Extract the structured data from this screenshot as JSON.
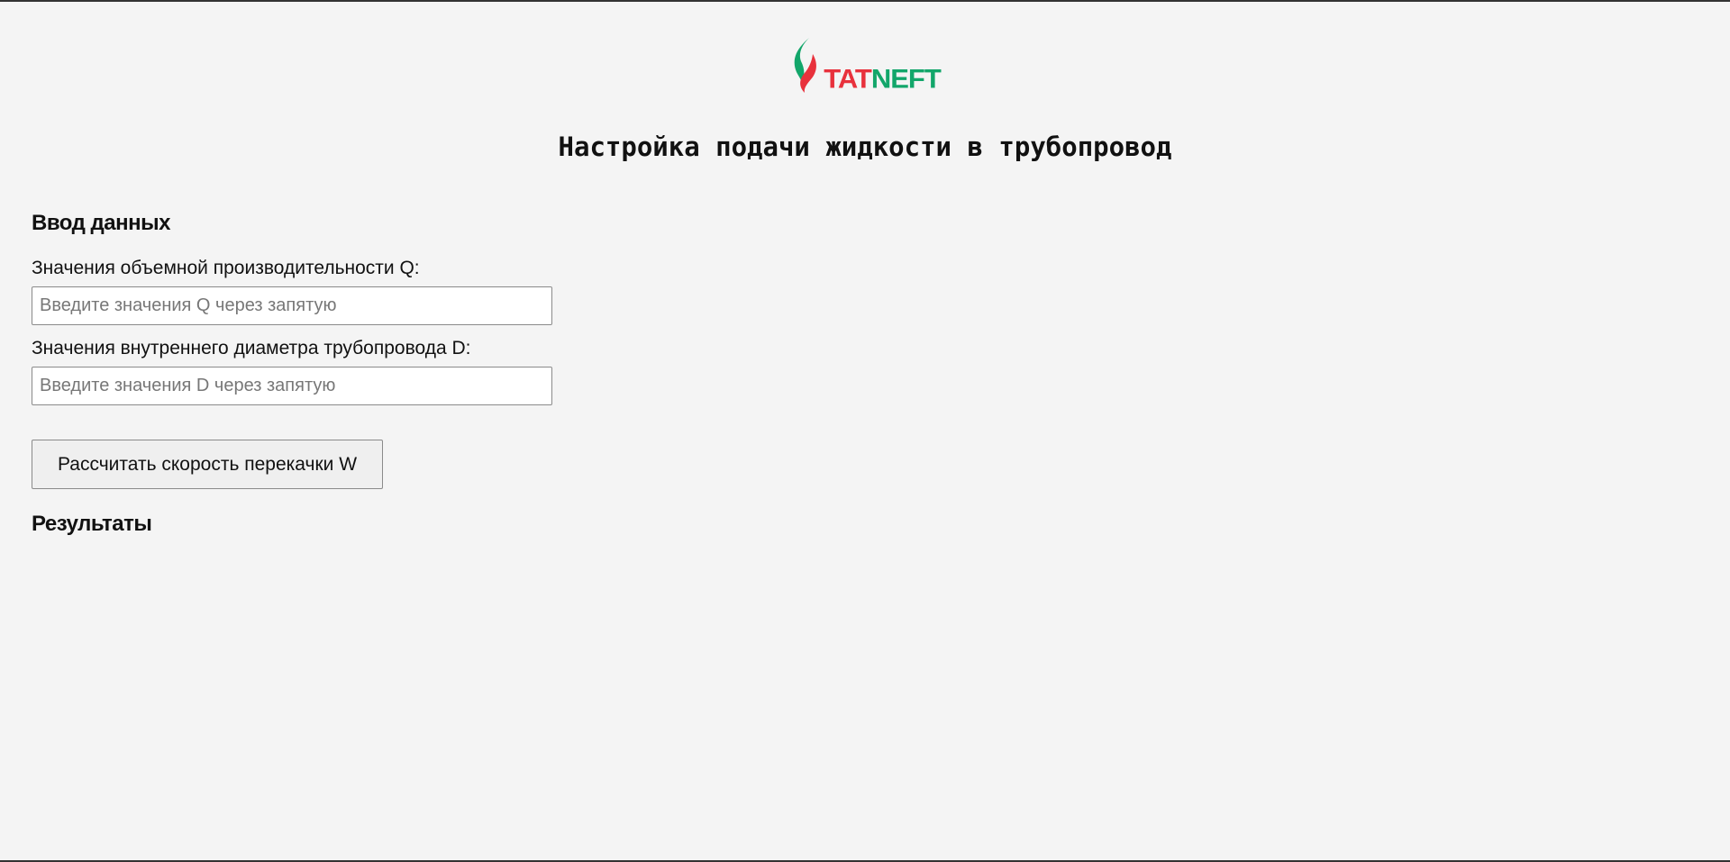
{
  "logo": {
    "text_red": "TAT",
    "text_green": "NEFT",
    "colors": {
      "red": "#e8313c",
      "green": "#12a66a"
    },
    "icon": "flame-logo-icon"
  },
  "page": {
    "title": "Настройка подачи жидкости в трубопровод"
  },
  "input_section": {
    "heading": "Ввод данных",
    "q_label": "Значения объемной производительности Q:",
    "q_placeholder": "Введите значения Q через запятую",
    "q_value": "",
    "d_label": "Значения внутреннего диаметра трубопровода D:",
    "d_placeholder": "Введите значения D через запятую",
    "d_value": "",
    "calculate_button": "Рассчитать скорость перекачки W"
  },
  "results_section": {
    "heading": "Результаты"
  }
}
